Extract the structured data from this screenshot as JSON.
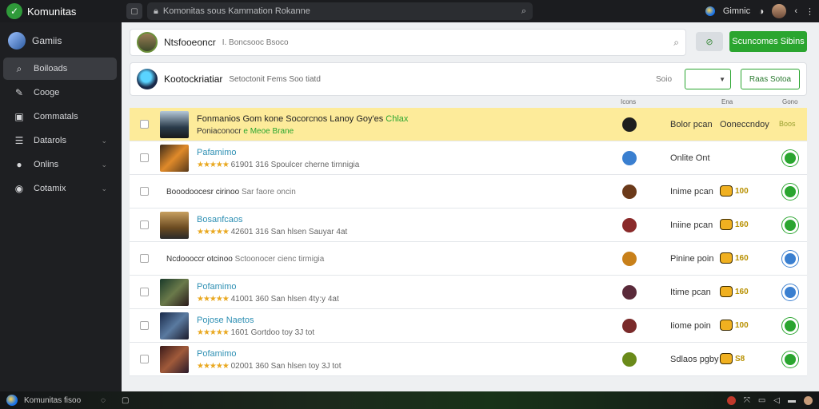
{
  "app": {
    "name": "Komunitas",
    "profile": "Gamiis"
  },
  "top": {
    "url": "Komonitas sous Kammation Rokanne",
    "profile_label": "Gimnic"
  },
  "sidebar": {
    "items": [
      {
        "label": "Boiloads",
        "icon": "search-icon",
        "glyph": "⌕",
        "active": true,
        "chevron": false
      },
      {
        "label": "Cooge",
        "icon": "wrench-icon",
        "glyph": "✎",
        "active": false,
        "chevron": false
      },
      {
        "label": "Commatals",
        "icon": "folder-icon",
        "glyph": "▣",
        "active": false,
        "chevron": false
      },
      {
        "label": "Datarols",
        "icon": "list-icon",
        "glyph": "☰",
        "active": false,
        "chevron": true
      },
      {
        "label": "Onlins",
        "icon": "coin-icon",
        "glyph": "●",
        "active": false,
        "chevron": true
      },
      {
        "label": "Cotamix",
        "icon": "globe-icon",
        "glyph": "◉",
        "active": false,
        "chevron": true
      }
    ]
  },
  "search_card": {
    "title": "Ntsfooeoncr",
    "meta": "I.  Boncsooc   Bsoco",
    "button_label": "Scuncomes Sibins"
  },
  "filter_card": {
    "title": "Kootockriatiar",
    "meta": "Setoctonit  Fems  Soo  tiatd",
    "filter_label": "Soio",
    "action_label": "Raas Sotoa"
  },
  "col_headers": [
    "Icons",
    "Ena",
    "Gono"
  ],
  "rows": [
    {
      "type": "highlight",
      "thumb": "t1",
      "title": "Fonmanios Gom kone Socorcnos Lanoy Goy'es",
      "title_green": "Chlax",
      "sub": "Poniaconocr",
      "sub_green": "e Meoe Brane",
      "status_color": "#1e1e1e",
      "status": "",
      "badge_text": "Bolor pcan",
      "badge_text2": "Ooneccndoy",
      "badge_text3": "Boos",
      "end": ""
    },
    {
      "type": "media",
      "thumb": "t2",
      "title": "Pafamimo",
      "stars": "★★★★★",
      "sub_num": "61901 316",
      "sub": "Spoulcer cherne tirnnigia",
      "status_color": "#3a7fd0",
      "status": "Onlite  Ont",
      "badge": "",
      "end": "#2aa52f"
    },
    {
      "type": "text",
      "main": "Booodoocesr cirinoo",
      "light": "Sar faore  oncin",
      "status_color": "#6b3a1a",
      "status": "Inime pcan",
      "badge": "100",
      "end": "#2aa52f"
    },
    {
      "type": "media",
      "thumb": "t3",
      "title": "Bosanfcaos",
      "stars": "★★★★★",
      "sub_num": "42601 316",
      "sub": "San hlsen Sauyar 4at",
      "status_color": "#8a2a2a",
      "status": "Iniine pcan",
      "badge": "160",
      "end": "#2aa52f"
    },
    {
      "type": "text",
      "main": "Ncdoooccr otcinoo",
      "light": "Sctoonocer cienc tirmigia",
      "status_color": "#c8801a",
      "status": "Pinine poin",
      "badge": "160",
      "end": "#3a7fd0"
    },
    {
      "type": "media",
      "thumb": "t4",
      "title": "Pofamimo",
      "stars": "★★★★★",
      "sub_num": "41001 360",
      "sub": "San hlsen 4ty:y 4at",
      "status_color": "#5a2a3a",
      "status": "Itime pcan",
      "badge": "160",
      "end": "#3a7fd0"
    },
    {
      "type": "media",
      "thumb": "t5",
      "title": "Pojose Naetos",
      "stars": "★★★★★",
      "sub_num": "1601 Gortdoo",
      "sub": "toy 3J tot",
      "status_color": "#7a2a2a",
      "status": "Iiome poin",
      "badge": "100",
      "end": "#2aa52f"
    },
    {
      "type": "media",
      "thumb": "t6",
      "title": "Pofamimo",
      "stars": "★★★★★",
      "sub_num": "02001 360",
      "sub": "San hlsen toy 3J tot",
      "status_color": "#6a8a1a",
      "status": "Sdlaos pgby",
      "badge": "S8",
      "end": "#2aa52f"
    }
  ],
  "taskbar": {
    "app_label": "Komunitas fisoo"
  }
}
